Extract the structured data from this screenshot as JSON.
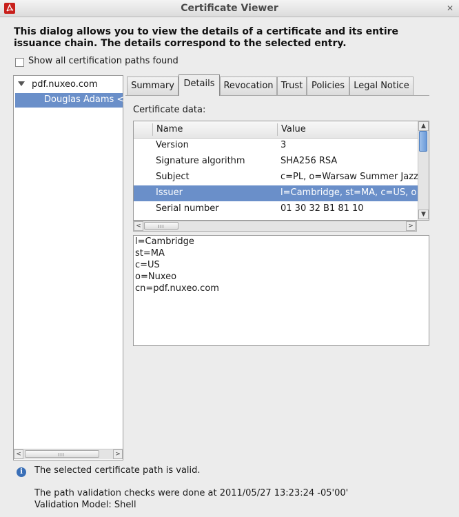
{
  "window": {
    "title": "Certificate Viewer",
    "close_glyph": "✕"
  },
  "intro": "This dialog allows you to view the details of a certificate and its entire issuance chain. The details correspond to the selected entry.",
  "show_all_checkbox": {
    "label": "Show all certification paths found",
    "checked": false
  },
  "tree": {
    "root": "pdf.nuxeo.com",
    "child": "Douglas Adams <"
  },
  "tabs": [
    "Summary",
    "Details",
    "Revocation",
    "Trust",
    "Policies",
    "Legal Notice"
  ],
  "active_tab": "Details",
  "cert_data_label": "Certificate data:",
  "table": {
    "headers": {
      "name": "Name",
      "value": "Value"
    },
    "rows": [
      {
        "name": "Version",
        "value": "3"
      },
      {
        "name": "Signature algorithm",
        "value": "SHA256 RSA"
      },
      {
        "name": "Subject",
        "value": "c=PL, o=Warsaw Summer Jazz"
      },
      {
        "name": "Issuer",
        "value": "l=Cambridge, st=MA, c=US, o"
      },
      {
        "name": "Serial number",
        "value": "01 30 32 B1 81 10"
      }
    ],
    "selected": "Issuer"
  },
  "detail_lines": [
    "l=Cambridge",
    "st=MA",
    "c=US",
    "o=Nuxeo",
    "cn=pdf.nuxeo.com"
  ],
  "status": {
    "message": "The selected certificate path is valid.",
    "check_time": "The path validation checks were done at 2011/05/27 13:23:24 -05'00'",
    "model": "Validation Model: Shell"
  },
  "colors": {
    "selection": "#6a8fc9",
    "scroll_thumb": "#6a9ad9"
  },
  "icons": [
    "acrobat-icon",
    "close-icon",
    "info-icon",
    "expand-arrow-icon",
    "left-arrow-icon",
    "right-arrow-icon",
    "up-arrow-icon",
    "down-arrow-icon"
  ]
}
